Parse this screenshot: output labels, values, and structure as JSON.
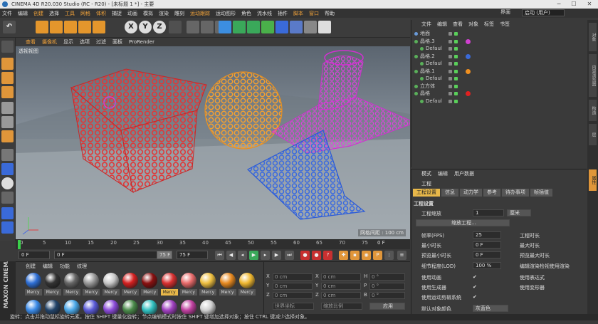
{
  "window": {
    "title": "CINEMA 4D R20.030 Studio (RC - R20) - [未标题 1 *] - 主要",
    "minimize": "─",
    "maximize": "☐",
    "close": "✕"
  },
  "menubar": {
    "items": [
      "文件",
      "编辑",
      "创建",
      "选择",
      "工具",
      "网格",
      "体积",
      "捕捉",
      "动画",
      "模拟",
      "渲染",
      "雕刻",
      "运动跟踪",
      "运动图形",
      "角色",
      "流水线",
      "插件",
      "脚本",
      "窗口",
      "帮助"
    ],
    "layout_label": "界面",
    "layout_value": "启动 (用户)"
  },
  "toolbar": {
    "undo": "↶",
    "axis_x": "X",
    "axis_y": "Y",
    "axis_z": "Z"
  },
  "viewport": {
    "menu": [
      "查看",
      "摄像机",
      "显示",
      "选项",
      "过滤",
      "面板",
      "ProRender"
    ],
    "label": "透视视图",
    "grid_spacing": "网格间距 : 100 cm"
  },
  "timeline": {
    "ticks": [
      "0",
      "5",
      "10",
      "15",
      "20",
      "25",
      "30",
      "35",
      "40",
      "45",
      "50",
      "55",
      "60",
      "65",
      "70",
      "75"
    ],
    "end_frame": "0 F"
  },
  "playbar": {
    "current": "0 F",
    "start": "0 F",
    "end": "75 F",
    "max": "75 F"
  },
  "materials": {
    "menu": [
      "创建",
      "编辑",
      "功能",
      "纹理"
    ],
    "label": "Mercy",
    "items": [
      {
        "color": "#2e6fd6"
      },
      {
        "color": "#333333"
      },
      {
        "color": "#666666"
      },
      {
        "color": "#999999"
      },
      {
        "color": "#c8c8c8"
      },
      {
        "color": "#d42020"
      },
      {
        "color": "#8a1010"
      },
      {
        "color": "#d83030",
        "selected": true
      },
      {
        "color": "#e86a6a"
      },
      {
        "color": "#f0c040"
      },
      {
        "color": "#e88a20"
      },
      {
        "color": "#f0b830"
      },
      {
        "color": "#3a8ae8"
      },
      {
        "color": "#22446a"
      },
      {
        "color": "#4aa8e8"
      },
      {
        "color": "#5a5ad8"
      },
      {
        "color": "#8a4ad8"
      },
      {
        "color": "#4a8a4a"
      },
      {
        "color": "#30c0c0"
      },
      {
        "color": "#a040c0"
      },
      {
        "color": "#c040a0"
      },
      {
        "color": "#d0d0d0"
      }
    ]
  },
  "coords": {
    "rows": [
      {
        "a": "X",
        "av": "0 cm",
        "b": "X",
        "bv": "0 cm",
        "c": "H",
        "cv": "0 °"
      },
      {
        "a": "Y",
        "av": "0 cm",
        "b": "Y",
        "bv": "0 cm",
        "c": "P",
        "cv": "0 °"
      },
      {
        "a": "Z",
        "av": "0 cm",
        "b": "Z",
        "bv": "0 cm",
        "c": "B",
        "cv": "0 °"
      }
    ],
    "mode1": "世界坐标",
    "mode2": "缩放比例",
    "apply": "应用"
  },
  "objects": {
    "menu": [
      "文件",
      "编辑",
      "查看",
      "对象",
      "标签",
      "书签"
    ],
    "rows": [
      {
        "name": "地面",
        "indent": 0,
        "icon": "#6a9ad8"
      },
      {
        "name": "晶格.3",
        "indent": 0,
        "icon": "#5ab05a",
        "tag": "#d040d0"
      },
      {
        "name": "Defaul",
        "indent": 1,
        "icon": "#5ab05a"
      },
      {
        "name": "晶格.2",
        "indent": 0,
        "icon": "#5ab05a",
        "tag": "#3a6ad8"
      },
      {
        "name": "Defaul",
        "indent": 1,
        "icon": "#5ab05a"
      },
      {
        "name": "晶格.1",
        "indent": 0,
        "icon": "#5ab05a",
        "tag": "#f09020"
      },
      {
        "name": "Defaul",
        "indent": 1,
        "icon": "#5ab05a"
      },
      {
        "name": "立方体",
        "indent": 0,
        "icon": "#5ab05a"
      },
      {
        "name": "晶格",
        "indent": 0,
        "icon": "#5ab05a",
        "tag": "#e02020"
      },
      {
        "name": "Defaul",
        "indent": 1,
        "icon": "#5ab05a"
      }
    ]
  },
  "attributes": {
    "menu": [
      "模式",
      "编辑",
      "用户数据"
    ],
    "header": "工程",
    "tabs": [
      "工程设置",
      "信息",
      "动力学",
      "参考",
      "待办事项",
      "帧插值"
    ],
    "section": "工程设置",
    "scale_label": "工程缩放",
    "scale_value": "1",
    "scale_unit": "厘米",
    "scale_button": "缩放工程...",
    "fps_label": "帧率(FPS)",
    "fps_value": "25",
    "project_time_label": "工程时长",
    "min_time_label": "最小时长",
    "min_time_value": "0 F",
    "max_time_label": "最大时长",
    "preview_min_label": "预览最小时长",
    "preview_min_value": "0 F",
    "preview_max_label": "预览最大时长",
    "lod_label": "细节程度(LOD)",
    "lod_value": "100 %",
    "render_lod_label": "编辑渲染检视使用渲染",
    "anim_label": "使用动画",
    "expr_label": "使用表达式",
    "gen_label": "使用生成器",
    "deform_label": "使用变形器",
    "motion_label": "使用运动剪辑系统",
    "color_label": "默认对象颜色",
    "color_value": "灰蓝色"
  },
  "statusbar": {
    "text": "旋转：点击并拖动鼠标旋转元素。按住 SHIFT 键量化旋转；节点编辑模式时按住 SHIFT 键增加选择对象；按住 CTRL 键减少选择对象。"
  },
  "brand": {
    "name": "MAXON CINEMA 4D"
  },
  "right_strip": [
    "对象",
    "内容浏览器",
    "构造",
    "层",
    "属性"
  ]
}
